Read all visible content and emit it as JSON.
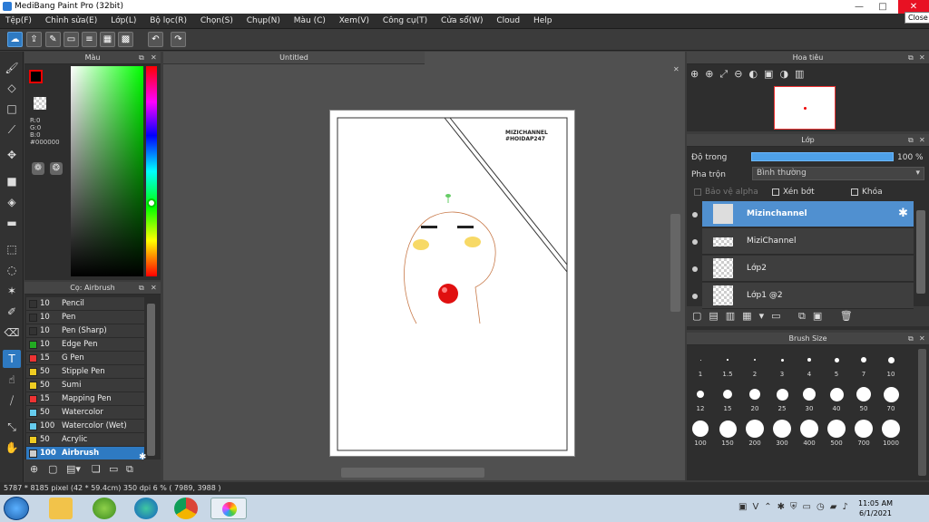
{
  "titlebar": {
    "title": "MediBang Paint Pro (32bit)",
    "close_tooltip": "Close",
    "minimize": "—",
    "maximize": "□",
    "close": "✕"
  },
  "menu": [
    "Tệp(F)",
    "Chỉnh sửa(E)",
    "Lớp(L)",
    "Bộ lọc(R)",
    "Chọn(S)",
    "Chụp(N)",
    "Màu (C)",
    "Xem(V)",
    "Công cụ(T)",
    "Cửa sổ(W)",
    "Cloud",
    "Help"
  ],
  "color_panel": {
    "title": "Màu",
    "r": "R:0",
    "g": "G:0",
    "b": "B:0",
    "hex": "#000000"
  },
  "brush_panel": {
    "title": "Cọ: Airbrush",
    "brushes": [
      {
        "size": "10",
        "name": "Pencil",
        "color": "#333333"
      },
      {
        "size": "10",
        "name": "Pen",
        "color": "#333333"
      },
      {
        "size": "10",
        "name": "Pen (Sharp)",
        "color": "#333333"
      },
      {
        "size": "10",
        "name": "Edge Pen",
        "color": "#22aa22"
      },
      {
        "size": "15",
        "name": "G Pen",
        "color": "#ee3333"
      },
      {
        "size": "50",
        "name": "Stipple Pen",
        "color": "#eecc22"
      },
      {
        "size": "50",
        "name": "Sumi",
        "color": "#eecc22"
      },
      {
        "size": "15",
        "name": "Mapping Pen",
        "color": "#ee3333"
      },
      {
        "size": "50",
        "name": "Watercolor",
        "color": "#66ccee"
      },
      {
        "size": "100",
        "name": "Watercolor (Wet)",
        "color": "#66ccee"
      },
      {
        "size": "50",
        "name": "Acrylic",
        "color": "#eecc22"
      },
      {
        "size": "100",
        "name": "Airbrush",
        "color": "#cccccc"
      }
    ]
  },
  "canvas": {
    "tab_title": "Untitled",
    "watermark_line1": "MIZICHANNEL",
    "watermark_line2": "#HOIDAP247"
  },
  "navigator": {
    "title": "Hoa tiêu"
  },
  "layer_panel": {
    "title": "Lớp",
    "opacity_label": "Độ trong",
    "opacity_value": "100 %",
    "blend_label": "Pha trộn",
    "blend_value": "Bình thường",
    "protect_alpha": "Bảo vệ alpha",
    "clipping": "Xén bớt",
    "lock": "Khóa",
    "layers": [
      "Mizinchannel",
      "MiziChannel",
      "Lớp2",
      "Lớp1 @2"
    ]
  },
  "brush_size": {
    "title": "Brush Size",
    "sizes": [
      "1",
      "1.5",
      "2",
      "3",
      "4",
      "5",
      "7",
      "10",
      "12",
      "15",
      "20",
      "25",
      "30",
      "40",
      "50",
      "70",
      "100",
      "150",
      "200",
      "300",
      "400",
      "500",
      "700",
      "1000"
    ]
  },
  "status": {
    "text": "5787 * 8185 pixel   (42 * 59.4cm)   350 dpi   6 %   ( 7989, 3988 )"
  },
  "taskbar": {
    "time": "11:05 AM",
    "date": "6/1/2021"
  }
}
